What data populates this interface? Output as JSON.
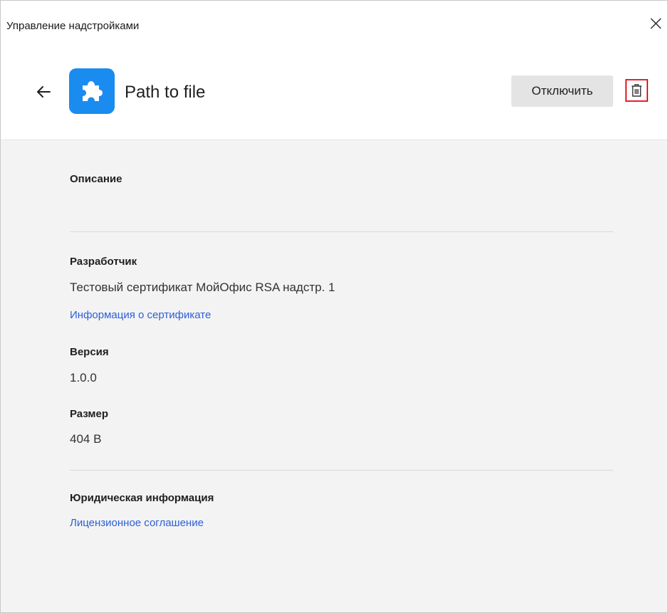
{
  "window": {
    "title": "Управление надстройками"
  },
  "icons": {
    "close": "close-icon",
    "back": "arrow-left-icon",
    "addon": "puzzle-icon",
    "delete": "trash-icon"
  },
  "colors": {
    "accent_icon_bg": "#1a8cf0",
    "link": "#2b5fd9",
    "delete_highlight": "#e8202a",
    "content_bg": "#f3f3f3",
    "button_bg": "#e4e4e4"
  },
  "header": {
    "addon_name": "Path to file",
    "disable_label": "Отключить"
  },
  "details": {
    "description_heading": "Описание",
    "description_value": "",
    "developer_heading": "Разработчик",
    "developer_value": "Тестовый сертификат МойОфис RSA надстр. 1",
    "certificate_link": "Информация о сертификате",
    "version_heading": "Версия",
    "version_value": "1.0.0",
    "size_heading": "Размер",
    "size_value": "404 B",
    "legal_heading": "Юридическая информация",
    "license_link": "Лицензионное соглашение"
  }
}
